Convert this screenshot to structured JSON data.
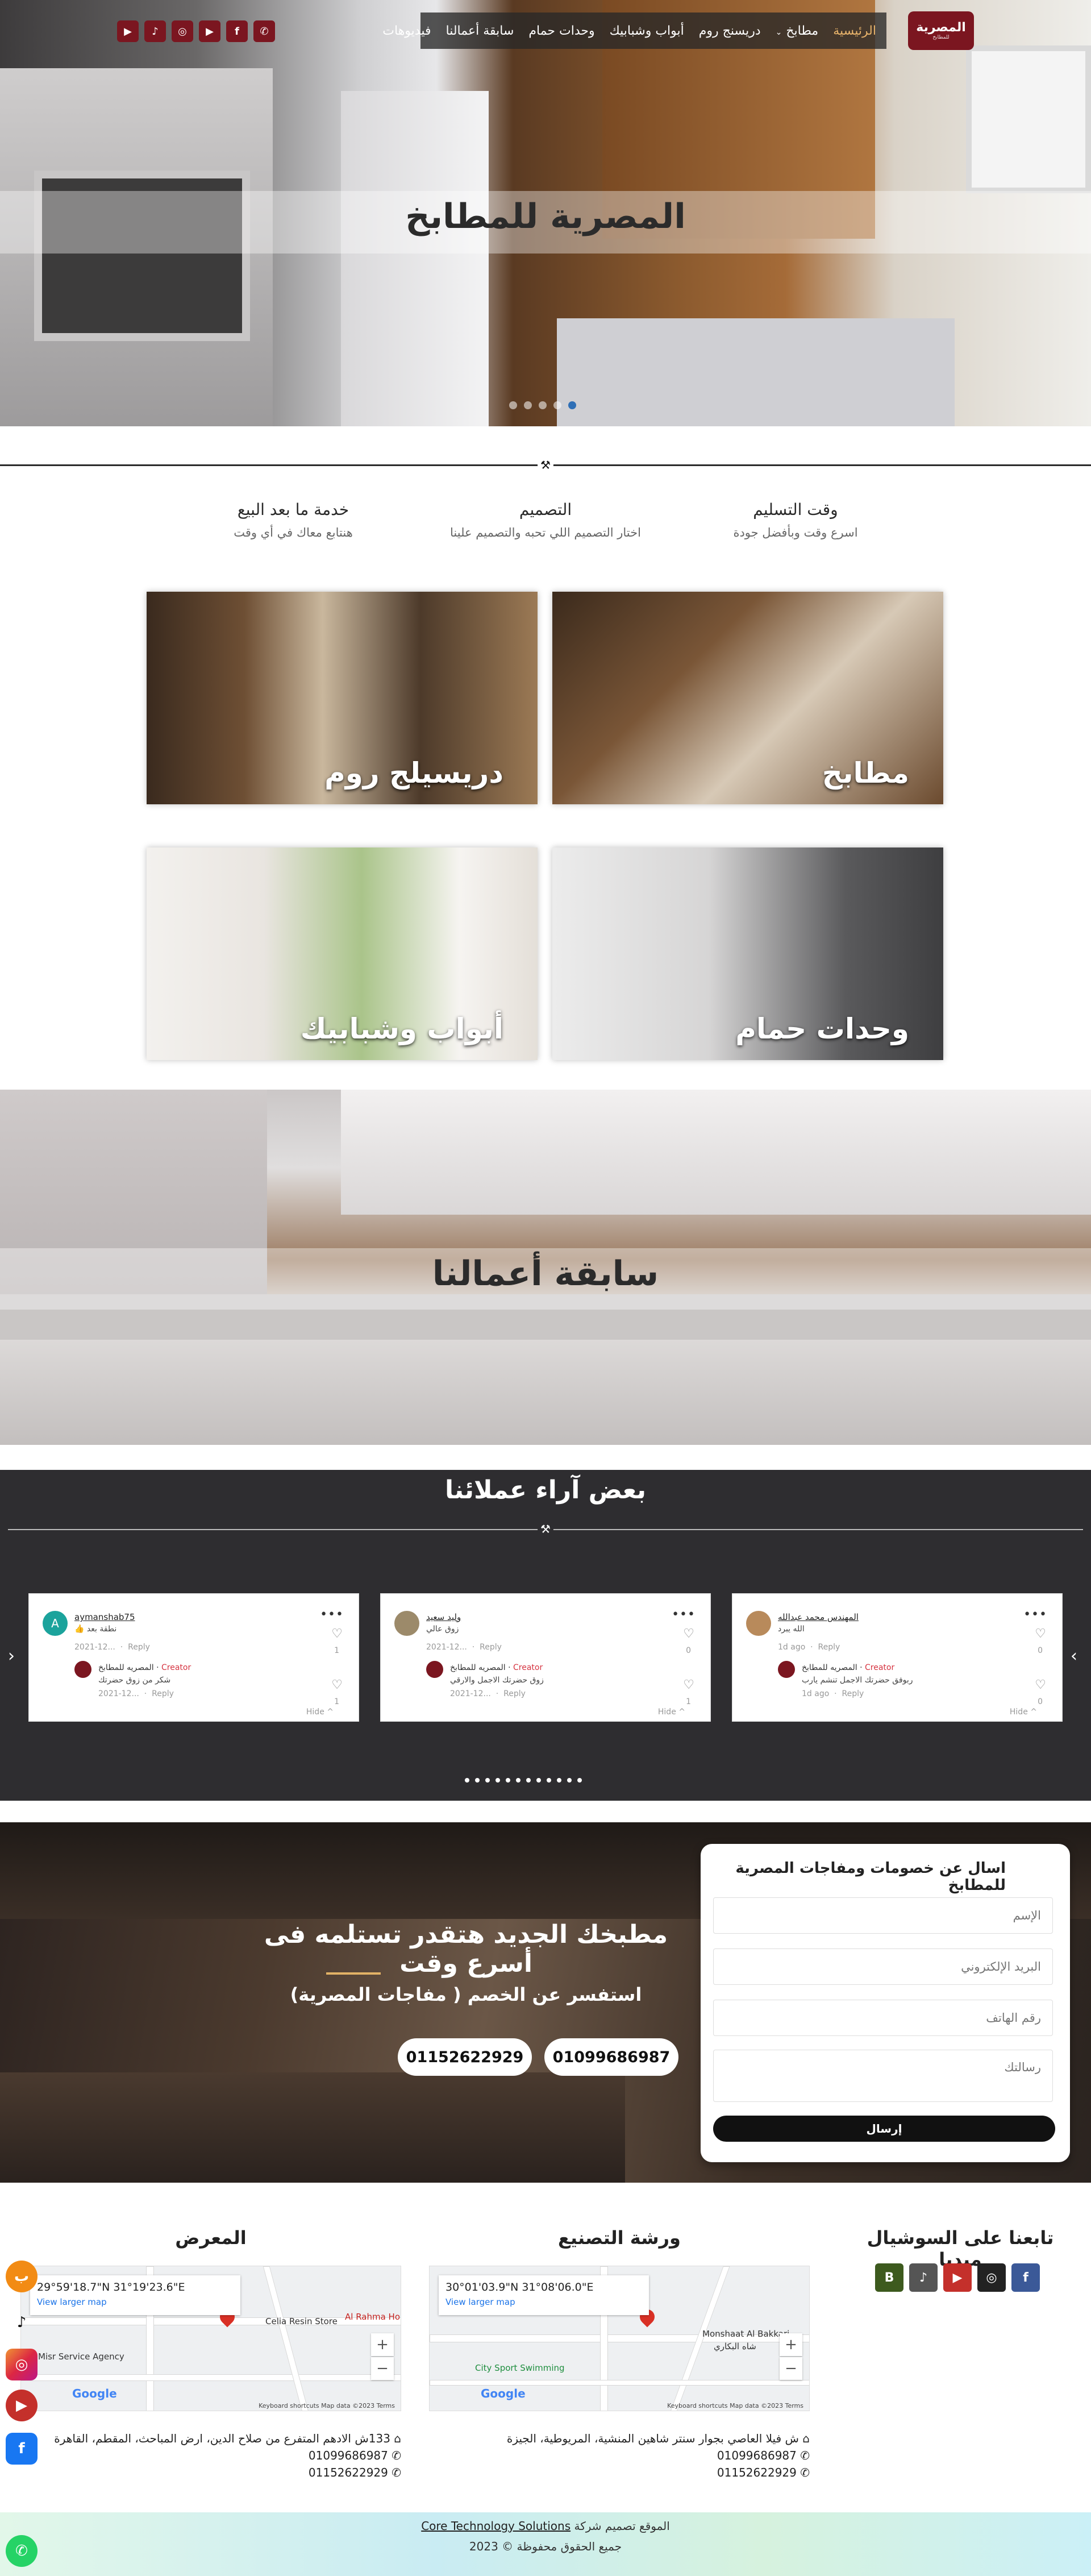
{
  "nav": {
    "items": [
      "الرئيسية",
      "مطابخ",
      "دريسنج روم",
      "أبواب وشبابيك",
      "وحدات حمام",
      "سابقة أعمالنا",
      "فيديوهات"
    ],
    "logo_text": "المصرية",
    "logo_sub": "للمطابخ",
    "social": [
      "whatsapp-icon",
      "facebook-icon",
      "youtube-icon",
      "instagram-icon",
      "tiktok-icon",
      "video-icon"
    ]
  },
  "hero": {
    "title": "المصرية للمطابخ"
  },
  "features": [
    {
      "title": "وقت التسليم",
      "subtitle": "اسرع وقت وبأفضل جودة"
    },
    {
      "title": "التصميم",
      "subtitle": "اختار التصميم اللي تحبه والتصميم علينا"
    },
    {
      "title": "خدمة ما بعد البيع",
      "subtitle": "هنتابع معاك في أي وقت"
    }
  ],
  "tiles": {
    "kitchens": "مطابخ",
    "dressing": "دريسيلج روم",
    "bathroom": "وحدات حمام",
    "doors": "أبواب وشبابيك"
  },
  "previous_work": {
    "title": "سابقة أعمالنا"
  },
  "testimonials": {
    "title": "بعض آراء عملائنا",
    "cards": [
      {
        "name": "المهندس محمد عبدالله",
        "comment": "الله يبرد",
        "date": "1d ago",
        "reply_label": "Reply",
        "likes": "0",
        "reply_author": "المصريه للمطابخ",
        "creator_label": "Creator",
        "reply_text": "ربوفق حضرتك الاجمل تنشم يارب",
        "reply_date": "1d ago",
        "reply_likes": "0",
        "hide_label": "Hide ^"
      },
      {
        "name": "وليد سعيد",
        "comment": "زوق عالي",
        "date": "2021-12...",
        "reply_label": "Reply",
        "likes": "0",
        "reply_author": "المصريه للمطابخ",
        "creator_label": "Creator",
        "reply_text": "زوق حضرتك الاجمل والارقي",
        "reply_date": "2021-12...",
        "reply_likes": "1",
        "hide_label": "Hide ^"
      },
      {
        "name": "aymanshab75",
        "comment": "👍 نطقة بعد",
        "date": "2021-12...",
        "reply_label": "Reply",
        "likes": "1",
        "reply_author": "المصريه للمطابخ",
        "creator_label": "Creator",
        "reply_text": "شكر من زوق حضرتك",
        "reply_date": "2021-12...",
        "reply_likes": "1",
        "hide_label": "Hide ^"
      }
    ]
  },
  "offer": {
    "title": "مطبخك الجديد هتقدر تستلمه فى أسرع وقت",
    "subtitle": "استفسر عن الخصم ( مفاجات المصرية)",
    "phone1": "01099686987",
    "phone2": "01152622929"
  },
  "form": {
    "title": "اسال عن خصومات ومفاجات المصرية للمطابخ",
    "name_placeholder": "الإسم",
    "email_placeholder": "البريد الإلكتروني",
    "phone_placeholder": "رقم الهاتف",
    "message_placeholder": "رسالتك",
    "submit_label": "إرسال"
  },
  "footer": {
    "social_title": "تابعنا على السوشيال ميديا",
    "workshop_title": "ورشة التصنيع",
    "showroom_title": "المعرض",
    "workshop_map": {
      "coords": "30°01'03.9\"N 31°08'06.0\"E",
      "view_larger": "View larger map",
      "place1": "Monshaat Al Bakkari",
      "place2": "شاه البكاري",
      "place3": "City Sport Swimming",
      "attribution": "Keyboard shortcuts   Map data ©2023   Terms",
      "google": "Google"
    },
    "showroom_map": {
      "coords": "29°59'18.7\"N 31°19'23.6\"E",
      "view_larger": "View larger map",
      "place1": "Celia Resin Store",
      "place2": "Al Rahma Ho",
      "place3": "Misr Service Agency",
      "attribution": "Keyboard shortcuts   Map data ©2023   Terms",
      "google": "Google"
    },
    "workshop_address": "ش فيلا العاصي بجوار سنتر شاهين المنشية، المريوطية، الجيزة",
    "workshop_phone1": "01099686987",
    "workshop_phone2": "01152622929",
    "showroom_address": "133ش الادهم المتفرع من صلاح الدين، ارض المباحث، المقطم، القاهرة",
    "showroom_phone1": "01099686987",
    "showroom_phone2": "01152622929",
    "copy_prefix": "الموقع تصميم شركة",
    "copy_company": "Core Technology Solutions",
    "copy_rights": "جميع الحقوق محفوظة © 2023"
  },
  "colors": {
    "brand": "#7b1620",
    "accent": "#e2b266",
    "dot_active": "#2f6fb6"
  }
}
